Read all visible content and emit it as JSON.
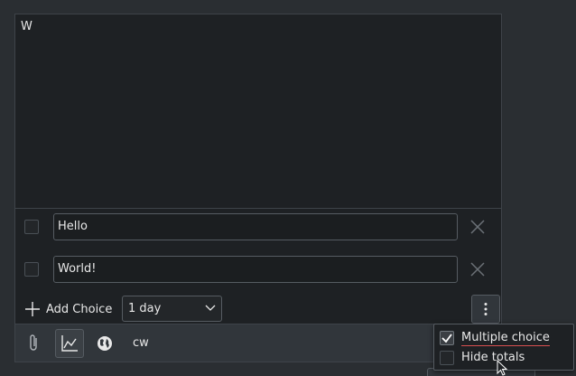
{
  "compose": {
    "text": "W"
  },
  "poll": {
    "choices": [
      {
        "value": "Hello"
      },
      {
        "value": "World!"
      }
    ],
    "add_choice_label": "Add Choice",
    "duration": "1 day"
  },
  "toolbar": {
    "cw_label": "cw"
  },
  "menu": {
    "items": [
      {
        "label": "Multiple choice",
        "checked": true
      },
      {
        "label": "Hide totals",
        "checked": false
      }
    ]
  },
  "icons": {
    "attach": "paperclip-icon",
    "poll": "poll-chart-icon",
    "visibility": "globe-icon",
    "add": "plus-icon",
    "remove": "close-icon",
    "menu": "kebab-menu-icon",
    "dropdown": "chevron-down-icon",
    "check": "checkmark-icon",
    "cursor": "mouse-pointer-icon"
  },
  "colors": {
    "background": "#2a2e32",
    "panel": "#1e2124",
    "toolbar": "#31363b",
    "border": "#565c62",
    "spellcheck_underline": "#d84f4f"
  }
}
